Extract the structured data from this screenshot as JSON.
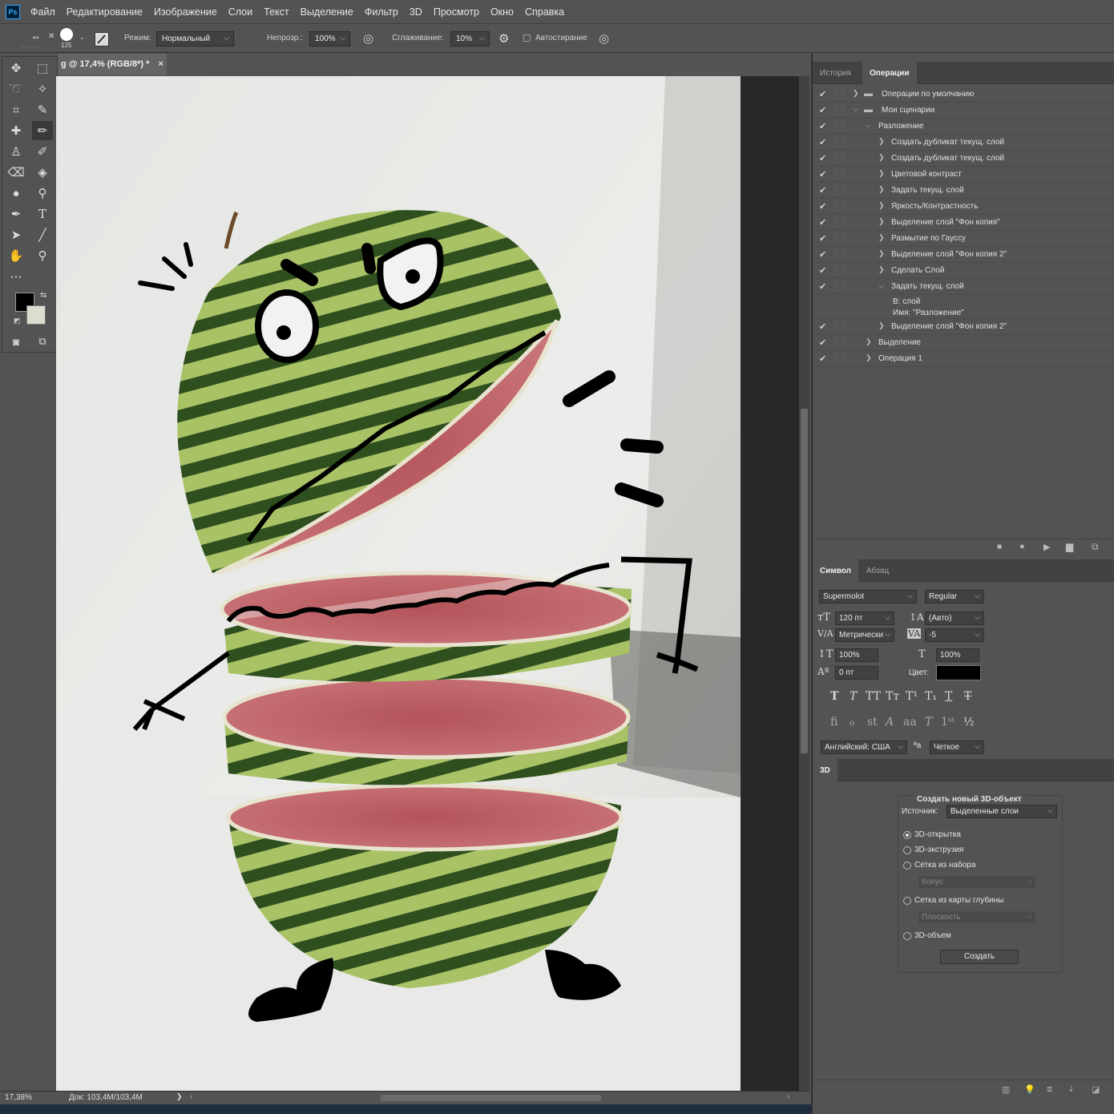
{
  "app": {
    "logo": "Ps"
  },
  "menu": [
    "Файл",
    "Редактирование",
    "Изображение",
    "Слои",
    "Текст",
    "Выделение",
    "Фильтр",
    "3D",
    "Просмотр",
    "Окно",
    "Справка"
  ],
  "options": {
    "brush_size": "125",
    "mode_label": "Режим:",
    "mode_value": "Нормальный",
    "opacity_label": "Непрозр.:",
    "opacity_value": "100%",
    "smoothing_label": "Сглаживание:",
    "smoothing_value": "10%",
    "autoerase_label": "Автостирание"
  },
  "document": {
    "tab_title": "g @ 17,4% (RGB/8*) *",
    "close": "×"
  },
  "status": {
    "zoom": "17,38%",
    "doc": "Док: 103,4М/103,4М",
    "arrow": "❯"
  },
  "panels": {
    "top_tabs": [
      "История",
      "Операции"
    ],
    "actions": [
      {
        "label": "Операции по умолчанию",
        "indent": 0,
        "folder": true,
        "open": false
      },
      {
        "label": "Мои сценарии",
        "indent": 0,
        "folder": true,
        "open": true
      },
      {
        "label": "Разложение",
        "indent": 1,
        "folder": false,
        "open": true
      },
      {
        "label": "Создать дубликат текущ. слой",
        "indent": 2,
        "open": false
      },
      {
        "label": "Создать дубликат текущ. слой",
        "indent": 2,
        "open": false
      },
      {
        "label": "Цветовой контраст",
        "indent": 2,
        "open": false
      },
      {
        "label": "Задать текущ. слой",
        "indent": 2,
        "open": false
      },
      {
        "label": "Яркость/Контрастность",
        "indent": 2,
        "open": false
      },
      {
        "label": "Выделение слой \"Фон копия\"",
        "indent": 2,
        "open": false
      },
      {
        "label": "Размытие по Гауссу",
        "indent": 2,
        "open": false
      },
      {
        "label": "Выделение слой \"Фон копия 2\"",
        "indent": 2,
        "open": false
      },
      {
        "label": "Сделать Слой",
        "indent": 2,
        "open": false
      },
      {
        "label": "Задать текущ. слой",
        "indent": 2,
        "open": true
      },
      {
        "label": "Выделение слой \"Фон копия 2\"",
        "indent": 2,
        "open": false
      },
      {
        "label": "Выделение",
        "indent": 1,
        "open": false
      },
      {
        "label": "Операция 1",
        "indent": 1,
        "open": false
      }
    ],
    "action_detail": {
      "line1": "В:  слой",
      "line2": "Имя:  \"Разложение\""
    },
    "char_tabs": [
      "Символ",
      "Абзац"
    ],
    "character": {
      "font": "Supermolot",
      "style": "Regular",
      "size": "120 пт",
      "leading": "(Авто)",
      "kerning": "Метрически",
      "tracking": "-5",
      "vscale": "100%",
      "hscale": "100%",
      "baseline": "0 пт",
      "color_label": "Цвет:",
      "color": "#000000",
      "language": "Английский: США",
      "aa_icon": "ªa",
      "antialias": "Четкое"
    },
    "tab3d": "3D",
    "new3d": {
      "title": "Создать новый 3D-объект",
      "source_label": "Источник:",
      "source_value": "Выделенные слои",
      "options": [
        "3D-открытка",
        "3D-экструзия",
        "Сетка из набора",
        "Сетка из карты глубины",
        "3D-объем"
      ],
      "selected": "3D-открытка",
      "preset_value": "Конус",
      "depth_value": "Плоскость",
      "create_button": "Создать"
    }
  },
  "colors": {
    "foreground": "#000000",
    "background": "#dcdccf",
    "accent": "#31a8ff"
  }
}
